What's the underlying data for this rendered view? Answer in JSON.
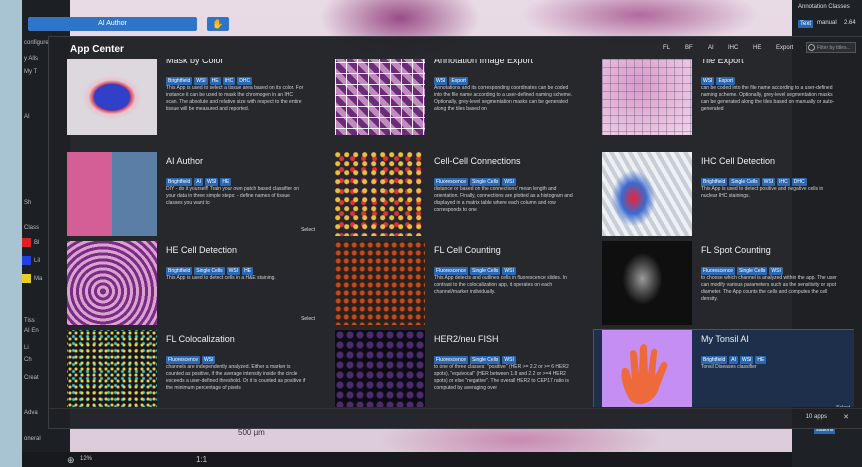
{
  "top": {
    "ai_author_button": "AI Author"
  },
  "left_panel": {
    "labels": [
      "configure",
      "y Alls",
      "My T",
      "AI",
      "Sh",
      "Class",
      "Bl",
      "Lil",
      "Ma",
      "Tiss",
      "AI En",
      "Li",
      "Ch",
      "Creat",
      "Adva",
      "oneral"
    ],
    "swatch_colors": [
      "#e02020",
      "#2040e0",
      "#e8d020"
    ]
  },
  "right_panel": {
    "title": "Annotation Classes",
    "items": [
      "Text",
      "manual",
      "2.64"
    ],
    "bottom_item": "stations"
  },
  "bottom": {
    "zoom": "12%",
    "ratio": "1:1",
    "scale_bar": "500 µm"
  },
  "modal": {
    "title": "App Center",
    "filters": [
      "FL",
      "BF",
      "AI",
      "IHC",
      "HE",
      "Export"
    ],
    "search_placeholder": "Filter by titles...",
    "apps_count": "10 apps",
    "apps": [
      {
        "title": "Mask by Color",
        "tags": [
          "Brightfield",
          "WSI",
          "HE",
          "IHC",
          "DHC"
        ],
        "desc": "This App is used to select a tissue area based on its color. For instance it can be used to mask the chromogen in an IHC scan. The absolute and relative size with respect to the entire tissue will be measured and reported.",
        "thumb": "th-mask",
        "select": ""
      },
      {
        "title": "Annotation Image Export",
        "tags": [
          "WSI",
          "Export"
        ],
        "desc": "Annotations and its corresponding coordinates can be coded into the file name according to a user-defined naming scheme. Optionally, grey-level segmentation masks can be generated along the tiles based on",
        "thumb": "th-ann",
        "select": ""
      },
      {
        "title": "Tile Export",
        "tags": [
          "WSI",
          "Export"
        ],
        "desc": "can be coded into the file name according to a user-defined naming scheme. Optionally, grey-level segmentation masks can be generated along the tiles based on manually or auto-generated",
        "thumb": "th-tile",
        "select": ""
      },
      {
        "title": "AI Author",
        "tags": [
          "Brightfield",
          "AI",
          "WSI",
          "HE"
        ],
        "desc": "DIY - do it yourself! Train your own patch based classifier on your data in three simple steps: - define names of tissue classes you want to",
        "thumb": "th-aiauth",
        "select": "Select"
      },
      {
        "title": "Cell-Cell Connections",
        "tags": [
          "Fluorescence",
          "Single Cells",
          "WSI"
        ],
        "desc": "distance or based on the connections' mean length and orientation. Finally, connections are plotted as a histogram and displayed in a matrix table where each column and row corresponds to one",
        "thumb": "th-cellconn",
        "select": ""
      },
      {
        "title": "IHC Cell Detection",
        "tags": [
          "Brightfield",
          "Single Cells",
          "WSI",
          "IHC",
          "DHC"
        ],
        "desc": "This App is used to detect positive and negative cells in nuclear IHC stainings.",
        "thumb": "th-ihc",
        "select": ""
      },
      {
        "title": "HE Cell Detection",
        "tags": [
          "Brightfield",
          "Single Cells",
          "WSI",
          "HE"
        ],
        "desc": "This App is used to detect cells in a H&E staining.",
        "thumb": "th-hecell",
        "select": "Select"
      },
      {
        "title": "FL Cell Counting",
        "tags": [
          "Fluorescence",
          "Single Cells",
          "WSI"
        ],
        "desc": "This App detects and outlines cells in fluorescence slides. In contrast to the colocalization app, it operates on each channel/marker individually.",
        "thumb": "th-flcount",
        "select": ""
      },
      {
        "title": "FL Spot Counting",
        "tags": [
          "Fluorescence",
          "Single Cells",
          "WSI"
        ],
        "desc": "to choose which channel is analyzed within the app. The user can modify various parameters such as the sensitivity or spot diameter. The App counts the cells and computes the cell density.",
        "thumb": "th-flspot",
        "select": ""
      },
      {
        "title": "FL Colocalization",
        "tags": [
          "Fluorescence",
          "WSI"
        ],
        "desc": "channels are independently analyzed. Either a marker is counted as positive, if the average intensity inside the circle exceeds a user-defined threshold. Or it is counted as positive if the minimum percentage of pixels",
        "thumb": "th-flcoloc",
        "select": ""
      },
      {
        "title": "HER2/neu FISH",
        "tags": [
          "Fluorescence",
          "Single Cells",
          "WSI"
        ],
        "desc": "to one of three classes: \"positive\" (HER >= 2.2 or >= 6 HER2 spots), \"equivocal\" (HER between 1.8 and 2.2 or >=4 HER2 spots) or else \"negative\". The overall HER2 to CEP17 ratio is computed by averaging over",
        "thumb": "th-fish",
        "select": ""
      },
      {
        "title": "My Tonsil AI",
        "tags": [
          "Brightfield",
          "AI",
          "WSI",
          "HE"
        ],
        "desc": "Tonsil Diseases classifier",
        "thumb": "th-tonsil",
        "select": "Select"
      }
    ]
  }
}
